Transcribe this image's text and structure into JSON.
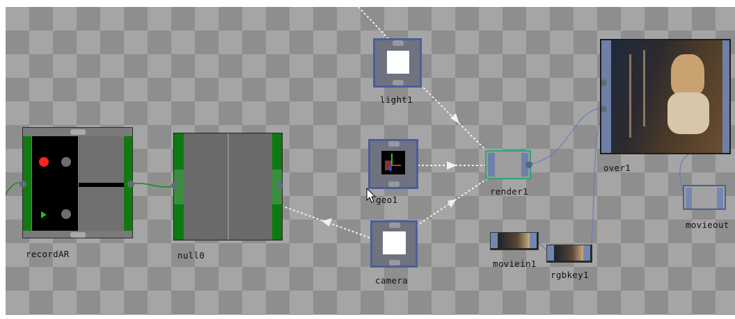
{
  "network": {
    "background": "checkerboard",
    "nodes": {
      "recordAR": {
        "label": "recordAR",
        "color": "#107a10"
      },
      "null0": {
        "label": "null0",
        "color": "#0c7a12"
      },
      "light1": {
        "label": "light1"
      },
      "geo1": {
        "label": "geo1"
      },
      "camera": {
        "label": "camera"
      },
      "render1": {
        "label": "render1"
      },
      "over1": {
        "label": "over1"
      },
      "moviein1": {
        "label": "moviein1"
      },
      "rgbkey1": {
        "label": "rgbkey1"
      },
      "movieout": {
        "label": "movieout"
      }
    },
    "accent_colors": {
      "node_frame": "#4a5e9a",
      "selected_frame": "#2fa37a",
      "green_wire": "#1a8a1a",
      "blue_wire": "#6a7cc0",
      "dotted_wire": "#ffffff"
    },
    "cursor": "arrow-cursor-icon"
  }
}
